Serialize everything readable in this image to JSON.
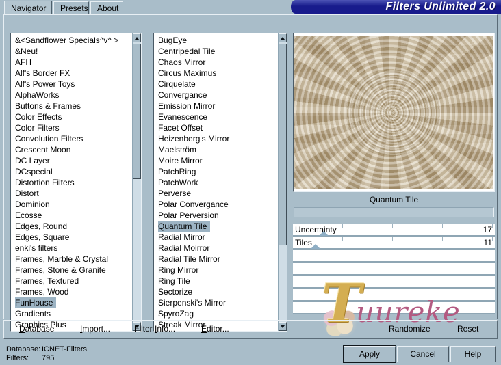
{
  "window": {
    "title": "Filters Unlimited 2.0"
  },
  "tabs": [
    {
      "label": "Navigator",
      "selected": true
    },
    {
      "label": "Presets",
      "selected": false
    },
    {
      "label": "About",
      "selected": false
    }
  ],
  "categories": {
    "selected": "FunHouse",
    "items": [
      "&<Sandflower Specials^v^ >",
      "&Neu!",
      "AFH",
      "Alf's Border FX",
      "Alf's Power Toys",
      "AlphaWorks",
      "Buttons & Frames",
      "Color Effects",
      "Color Filters",
      "Convolution Filters",
      "Crescent Moon",
      "DC Layer",
      "DCspecial",
      "Distortion Filters",
      "Distort",
      "Dominion",
      "Ecosse",
      "Edges, Round",
      "Edges, Square",
      "enki's filters",
      "Frames, Marble & Crystal",
      "Frames, Stone & Granite",
      "Frames, Textured",
      "Frames, Wood",
      "FunHouse",
      "Gradients",
      "Graphics Plus"
    ]
  },
  "filters": {
    "selected": "Quantum Tile",
    "items": [
      "BugEye",
      "Centripedal Tile",
      "Chaos Mirror",
      "Circus Maximus",
      "Cirquelate",
      "Convergance",
      "Emission Mirror",
      "Evanescence",
      "Facet Offset",
      "Heizenberg's Mirror",
      "Maelström",
      "Moire Mirror",
      "PatchRing",
      "PatchWork",
      "Perverse",
      "Polar Convergance",
      "Polar Perversion",
      "Quantum Tile",
      "Radial Mirror",
      "Radial Moirror",
      "Radial Tile Mirror",
      "Ring Mirror",
      "Ring Tile",
      "Sectorize",
      "Sierpenski's Mirror",
      "SpyroZag",
      "Streak Mirror"
    ]
  },
  "preview": {
    "filter_name": "Quantum Tile",
    "preset_value": ""
  },
  "sliders": [
    {
      "label": "Uncertainty",
      "value": "17",
      "thumb_pct": 17
    },
    {
      "label": "Tiles",
      "value": "11",
      "thumb_pct": 11
    }
  ],
  "empty_slider_rows": 5,
  "watermark": {
    "initial": "T",
    "rest": "uureke"
  },
  "menu": [
    {
      "label": "Database",
      "accel": "D"
    },
    {
      "label": "Import...",
      "accel": "I"
    },
    {
      "label": "Filter Info...",
      "accel": "I"
    },
    {
      "label": "Editor...",
      "accel": "E"
    },
    {
      "label": "Randomize",
      "accel": ""
    },
    {
      "label": "Reset",
      "accel": ""
    }
  ],
  "status": {
    "database_label": "Database:",
    "database_value": "ICNET-Filters",
    "filters_label": "Filters:",
    "filters_value": "795"
  },
  "buttons": {
    "apply": "Apply",
    "cancel": "Cancel",
    "help": "Help"
  },
  "colors": {
    "background": "#a9bdc9",
    "title_bar": "#181b8c",
    "selection": "#9db4c4",
    "list_bg": "#ffffff"
  }
}
